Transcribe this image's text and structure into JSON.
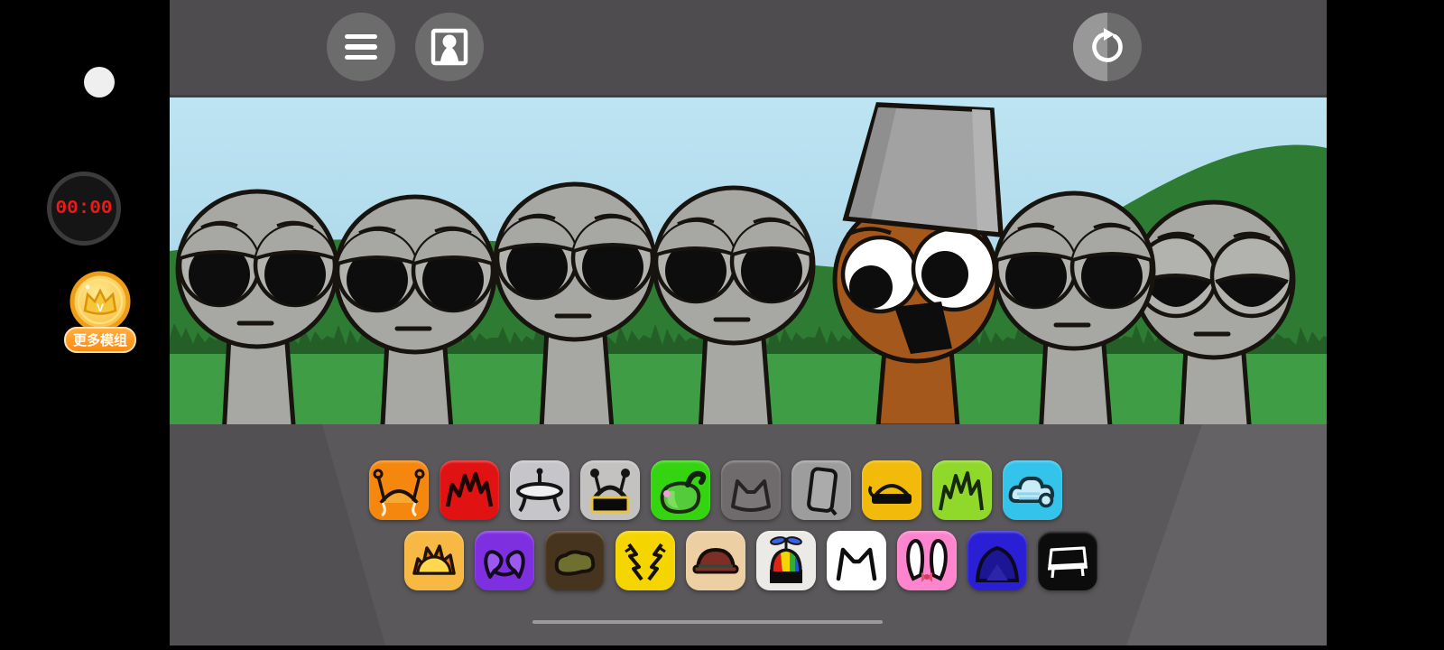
{
  "overlay": {
    "timer": "00:00",
    "mods_button_label": "更多模组",
    "coin_letter": "V"
  },
  "topbar": {
    "icons": [
      "menu",
      "avatar-frame",
      "reset"
    ]
  },
  "scene": {
    "colors": {
      "sky": "#bde4f2",
      "hill": "#2e7c33",
      "grass": "#3f9e45",
      "grass_blades": "#245f28",
      "character_gray": "#a7a7a3",
      "character_brown": "#a5581b",
      "bucket_gray": "#a2a2a2"
    },
    "characters": [
      {
        "type": "gray",
        "expression": "bored"
      },
      {
        "type": "gray",
        "expression": "bored"
      },
      {
        "type": "gray",
        "expression": "bored"
      },
      {
        "type": "gray",
        "expression": "bored"
      },
      {
        "type": "brown",
        "expression": "open-mouth",
        "hat": "bucket"
      },
      {
        "type": "gray",
        "expression": "bored"
      },
      {
        "type": "gray",
        "expression": "sleepy"
      }
    ]
  },
  "soundboard": {
    "row1": [
      {
        "icon": "orange-antennae",
        "color": "#f5870f"
      },
      {
        "icon": "red-spiky-hair",
        "color": "#e11212"
      },
      {
        "icon": "nail-table-hat",
        "color": "#c6c6ca"
      },
      {
        "icon": "antenna-visor-hat",
        "color": "#c4c2c0"
      },
      {
        "icon": "green-pepper",
        "color": "#35d410"
      },
      {
        "icon": "cat-ears-dimmed",
        "color": "#6f6b6c"
      },
      {
        "icon": "leaning-board",
        "color": "#9d9d9d"
      },
      {
        "icon": "gold-visor",
        "color": "#f2ba0a"
      },
      {
        "icon": "green-spiky-hair",
        "color": "#90d92b"
      },
      {
        "icon": "cloud",
        "color": "#34c3ea"
      }
    ],
    "row2": [
      {
        "icon": "sunrise",
        "color": "#f7b844"
      },
      {
        "icon": "devil-horns",
        "color": "#7e2fe0"
      },
      {
        "icon": "swamp-cap",
        "color": "#47341f"
      },
      {
        "icon": "lightning-bolts",
        "color": "#f5d500"
      },
      {
        "icon": "maroon-brim-hat",
        "color": "#eccfa2"
      },
      {
        "icon": "propeller-cap",
        "color": "#eceae6"
      },
      {
        "icon": "white-cat-ears",
        "color": "#ffffff"
      },
      {
        "icon": "bunny-ears",
        "color": "#fd85cd"
      },
      {
        "icon": "blue-hood",
        "color": "#2a1fd4"
      },
      {
        "icon": "bench",
        "color": "#0c0c0c"
      }
    ]
  }
}
